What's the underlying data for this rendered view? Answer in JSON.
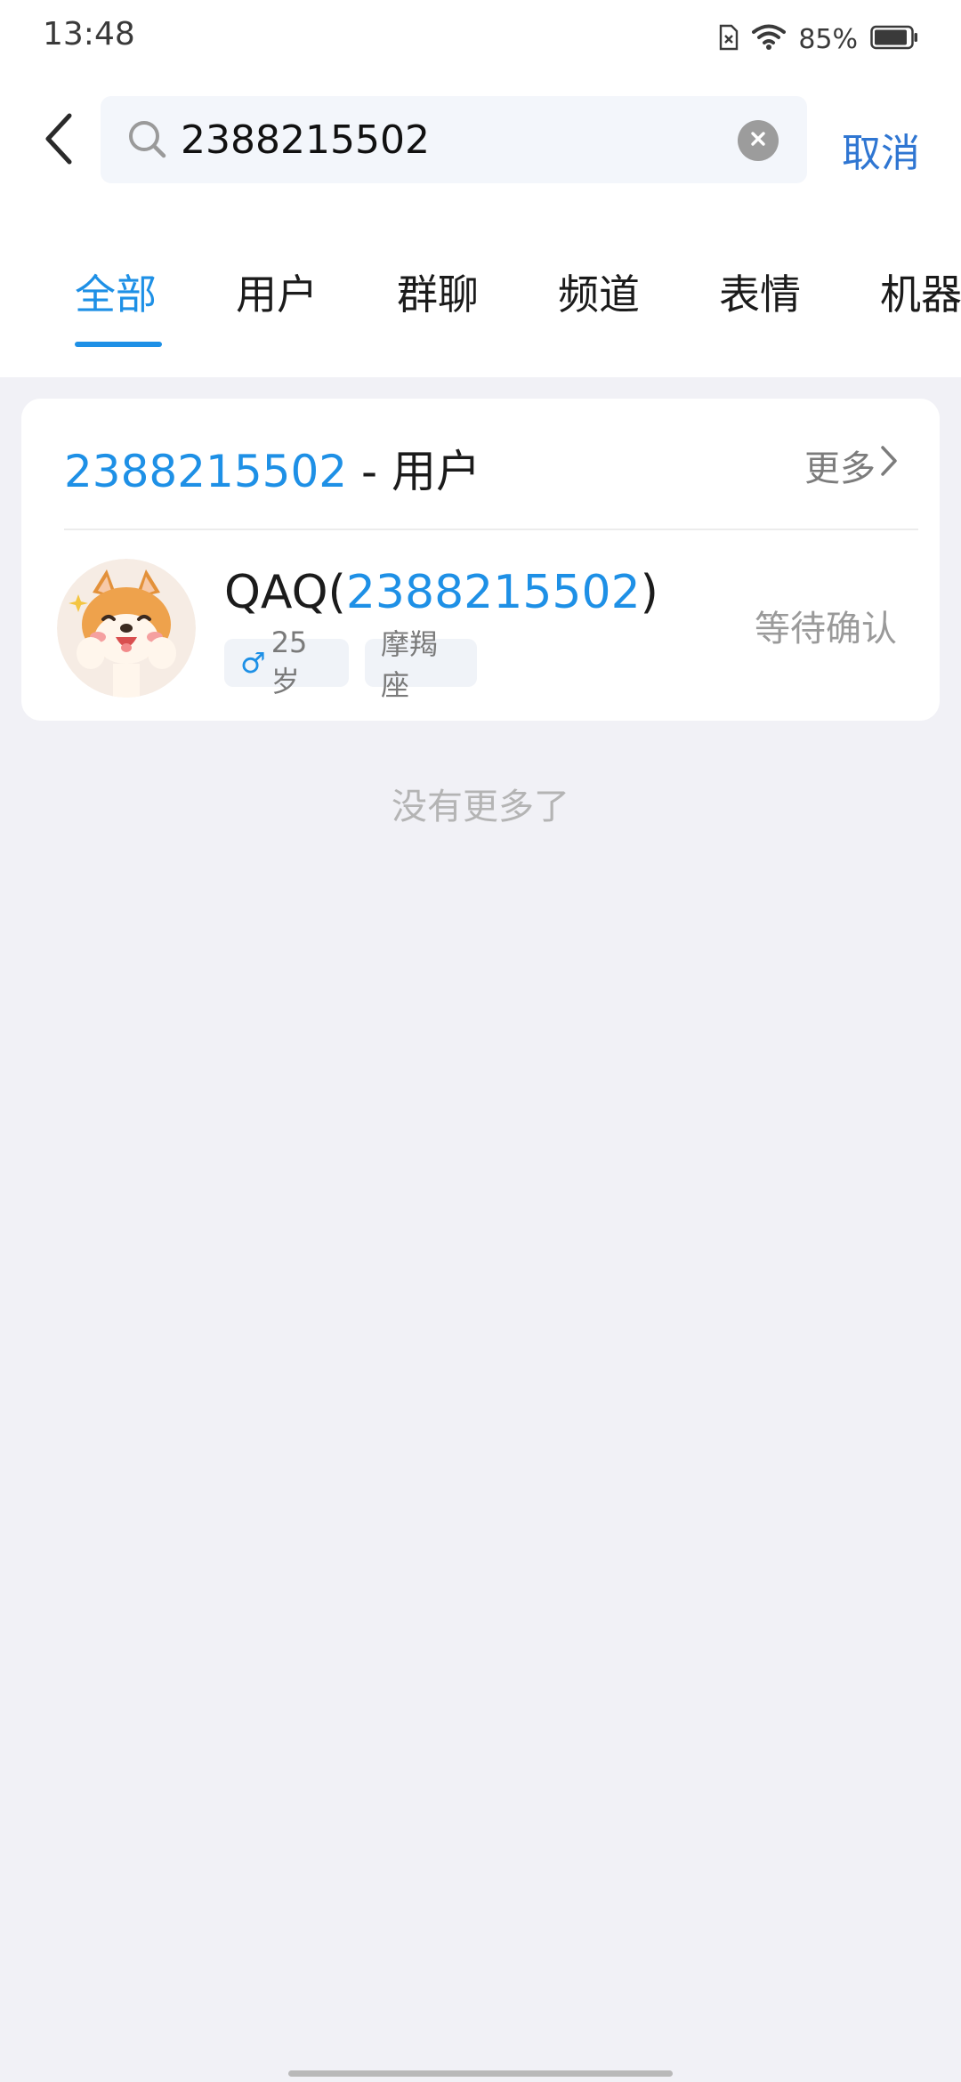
{
  "status_bar": {
    "time": "13:48",
    "battery": "85%",
    "icons": [
      "sim-no-card-icon",
      "wifi-icon",
      "battery-icon"
    ]
  },
  "search": {
    "query": "2388215502",
    "cancel_label": "取消"
  },
  "tabs": [
    {
      "label": "全部",
      "active": true
    },
    {
      "label": "用户",
      "active": false
    },
    {
      "label": "群聊",
      "active": false
    },
    {
      "label": "频道",
      "active": false
    },
    {
      "label": "表情",
      "active": false
    },
    {
      "label": "机器",
      "active": false
    }
  ],
  "result_section": {
    "query_highlight": "2388215502",
    "separator": " - ",
    "category": "用户",
    "more_label": "更多",
    "user": {
      "name": "QAQ",
      "open_paren": "(",
      "id": "2388215502",
      "close_paren": ")",
      "gender_symbol": "♂",
      "age": "25岁",
      "zodiac": "摩羯座",
      "status": "等待确认"
    }
  },
  "footer": {
    "no_more": "没有更多了"
  },
  "colors": {
    "accent": "#1e90e6",
    "cancel": "#2f76d2",
    "background": "#f1f1f6"
  }
}
